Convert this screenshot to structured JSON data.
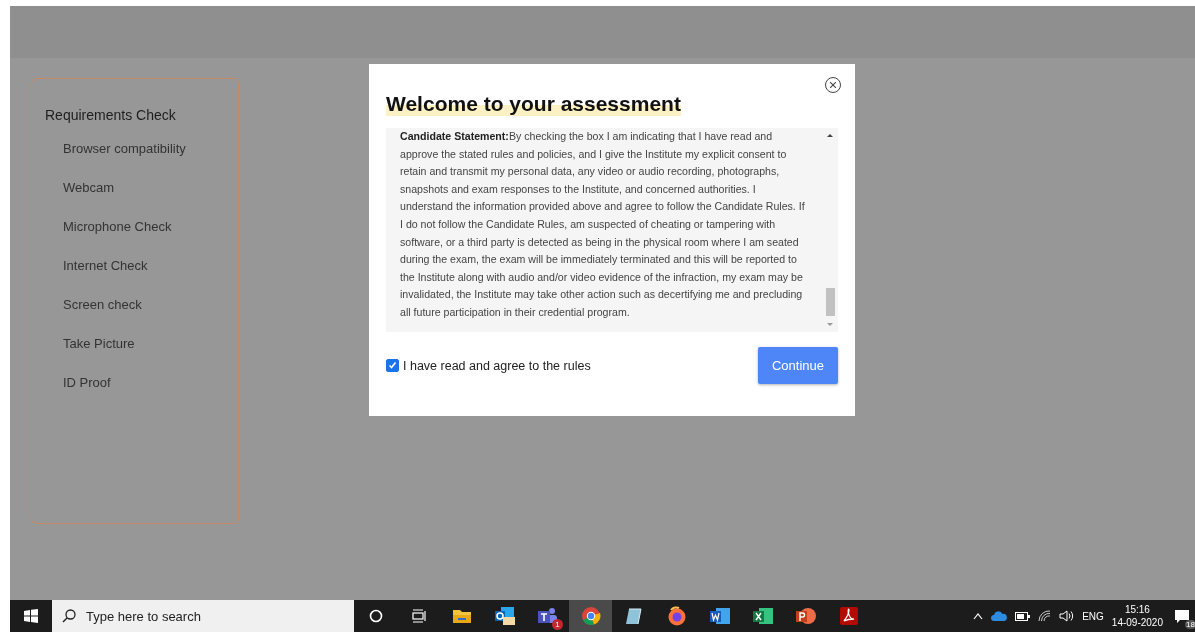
{
  "sidebar": {
    "title": "Requirements Check",
    "items": [
      "Browser compatibility",
      "Webcam",
      "Microphone Check",
      "Internet Check",
      "Screen check",
      "Take Picture",
      "ID Proof"
    ]
  },
  "modal": {
    "title": "Welcome to your assessment",
    "statement_label": "Candidate Statement:",
    "statement_text": "By checking the box I am indicating that I have read and approve the stated rules and policies, and I give the Institute my explicit consent to retain and transmit my personal data, any video or audio recording, photographs, snapshots and exam responses to the Institute, and concerned authorities. I understand the information provided above and agree to follow the Candidate Rules. If I do not follow the Candidate Rules, am suspected of cheating or tampering with software, or a third party is detected as being in the physical room where I am seated during the exam, the exam will be immediately terminated and this will be reported to the Institute along with audio and/or video evidence of the infraction, my exam may be invalidated, the Institute may take other action such as decertifying me and precluding all future participation in their credential program.",
    "agree": {
      "label": "I have read and agree to the rules",
      "checked": true
    },
    "button": "Continue"
  },
  "taskbar": {
    "search_placeholder": "Type here to search",
    "apps": [
      {
        "kind": "cortana",
        "selected": false
      },
      {
        "kind": "taskview",
        "selected": false
      },
      {
        "kind": "folder",
        "selected": false
      },
      {
        "kind": "outlook",
        "selected": false
      },
      {
        "kind": "teams",
        "selected": false,
        "badge": "1"
      },
      {
        "kind": "chrome",
        "selected": true
      },
      {
        "kind": "notebook",
        "selected": false
      },
      {
        "kind": "firefox",
        "selected": false
      },
      {
        "kind": "word",
        "selected": false
      },
      {
        "kind": "excel",
        "selected": false
      },
      {
        "kind": "powerpoint",
        "selected": false
      },
      {
        "kind": "pdf",
        "selected": false
      }
    ],
    "language": "ENG",
    "time": "15:16",
    "date": "14-09-2020",
    "notifications": "18"
  }
}
